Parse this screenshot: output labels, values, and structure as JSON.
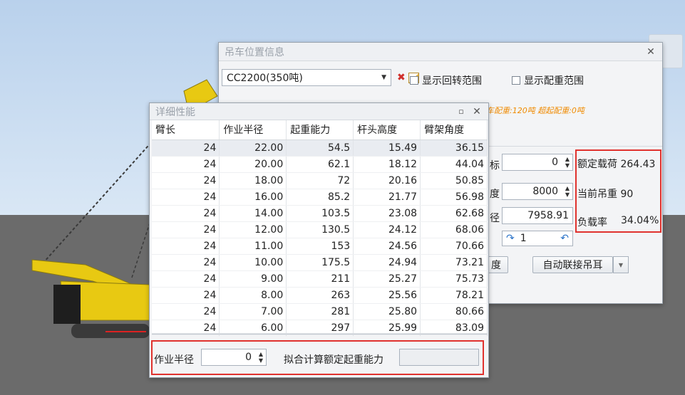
{
  "scene": {
    "corner_icon": "vertical-toolbar-icon"
  },
  "pos_window": {
    "title": "吊车位置信息",
    "crane_select": "CC2200(350吨)",
    "show_rotation": "显示回转范围",
    "show_counterweight": "显示配重范围",
    "counterweight_info": "车配重:120吨  超起配重:0吨",
    "coord_label": "标",
    "coord_value": "0",
    "height_label": "度",
    "height_value": "8000",
    "radius_label": "径",
    "radius_value": "7958.91",
    "rotation_value": "1",
    "angle_btn": "度",
    "auto_link_btn": "自动联接吊耳",
    "rated_load": "额定载荷 264.43",
    "current_weight": "当前吊重 90",
    "load_rate_label": "负载率",
    "load_rate_value": "34.04%"
  },
  "detail_window": {
    "title": "详细性能",
    "columns": [
      "臂长",
      "作业半径",
      "起重能力",
      "杆头高度",
      "臂架角度"
    ],
    "rows": [
      [
        "24",
        "22.00",
        "54.5",
        "15.49",
        "36.15"
      ],
      [
        "24",
        "20.00",
        "62.1",
        "18.12",
        "44.04"
      ],
      [
        "24",
        "18.00",
        "72",
        "20.16",
        "50.85"
      ],
      [
        "24",
        "16.00",
        "85.2",
        "21.77",
        "56.98"
      ],
      [
        "24",
        "14.00",
        "103.5",
        "23.08",
        "62.68"
      ],
      [
        "24",
        "12.00",
        "130.5",
        "24.12",
        "68.06"
      ],
      [
        "24",
        "11.00",
        "153",
        "24.56",
        "70.66"
      ],
      [
        "24",
        "10.00",
        "175.5",
        "24.94",
        "73.21"
      ],
      [
        "24",
        "9.00",
        "211",
        "25.27",
        "75.73"
      ],
      [
        "24",
        "8.00",
        "263",
        "25.56",
        "78.21"
      ],
      [
        "24",
        "7.00",
        "281",
        "25.80",
        "80.66"
      ],
      [
        "24",
        "6.00",
        "297",
        "25.99",
        "83.09"
      ]
    ],
    "radius_label": "作业半径",
    "radius_value": "0",
    "fit_label": "拟合计算额定起重能力",
    "fit_value": ""
  }
}
